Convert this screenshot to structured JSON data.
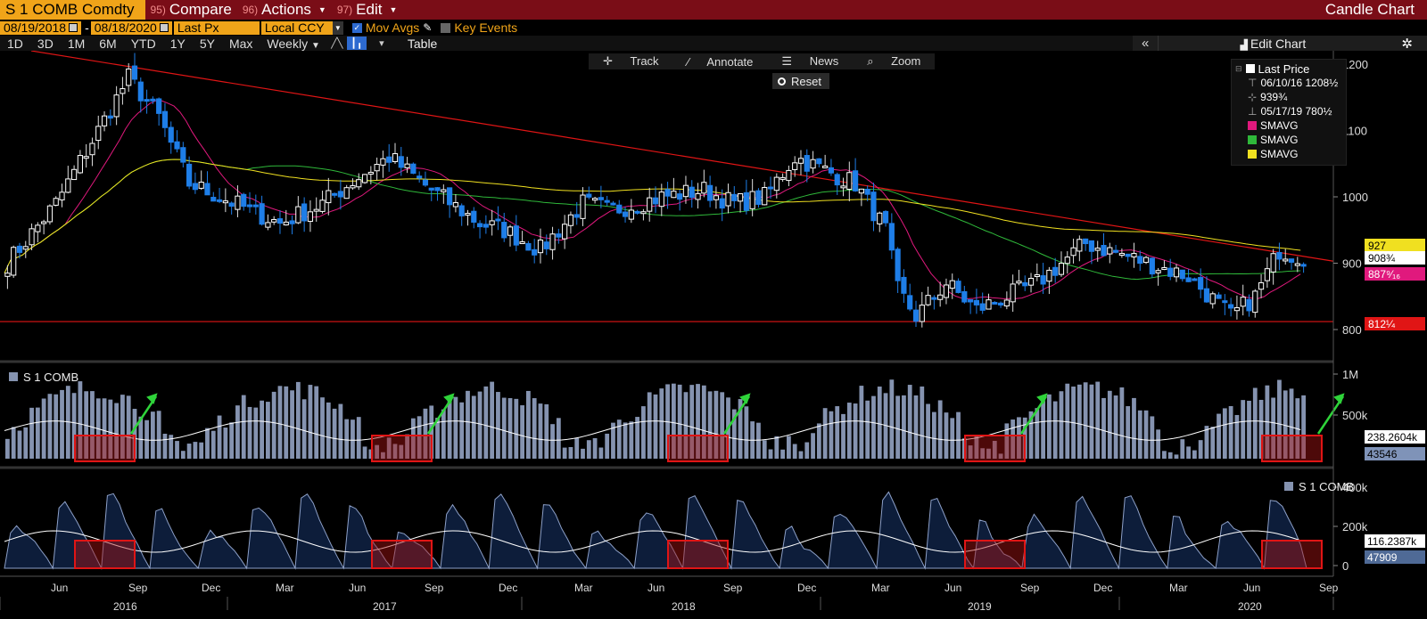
{
  "header": {
    "ticker": "S 1 COMB Comdty",
    "menus": [
      {
        "num": "95)",
        "label": "Compare",
        "caret": false
      },
      {
        "num": "96)",
        "label": "Actions",
        "caret": true
      },
      {
        "num": "97)",
        "label": "Edit",
        "caret": true
      }
    ],
    "chart_title": "Candle Chart"
  },
  "controls": {
    "start_date": "08/19/2018",
    "end_date": "08/18/2020",
    "date_sep": "-",
    "field": "Last Px",
    "currency": "Local CCY",
    "mov_avgs": "Mov Avgs",
    "key_events": "Key Events"
  },
  "periods": [
    "1D",
    "3D",
    "1M",
    "6M",
    "YTD",
    "1Y",
    "5Y",
    "Max"
  ],
  "frequency": "Weekly",
  "table_label": "Table",
  "edit_chart": "Edit Chart",
  "chart_tools": {
    "track": "Track",
    "annotate": "Annotate",
    "news": "News",
    "zoom": "Zoom",
    "reset": "Reset"
  },
  "legend": {
    "title": "Last Price",
    "high": "06/10/16 1208½",
    "avg": "939¾",
    "low": "05/17/19 780½",
    "sma": [
      {
        "label": "SMAVG",
        "color": "#e0197d"
      },
      {
        "label": "SMAVG",
        "color": "#2fb83a"
      },
      {
        "label": "SMAVG",
        "color": "#f0e020"
      }
    ]
  },
  "price_axis": {
    "ticks": [
      "1200",
      "1100",
      "1000",
      "900",
      "800"
    ],
    "tags": [
      {
        "text": "927",
        "bg": "#f0e020",
        "fg": "#000"
      },
      {
        "text": "908¾",
        "bg": "#ffffff",
        "fg": "#000"
      },
      {
        "text": "887⁹⁄₁₆",
        "bg": "#e0197d",
        "fg": "#fff"
      },
      {
        "text": "812¼",
        "bg": "#e01515",
        "fg": "#fff"
      }
    ]
  },
  "volume_panel": {
    "label": "S 1 COMB",
    "ticks": [
      "1M",
      "500k"
    ],
    "tags": [
      {
        "text": "238.2604k",
        "bg": "#ffffff",
        "fg": "#000"
      },
      {
        "text": "43546",
        "bg": "#7f93b8",
        "fg": "#000"
      }
    ]
  },
  "oi_panel": {
    "label": "S 1 COMB",
    "ticks": [
      "400k",
      "200k",
      "0"
    ],
    "tags": [
      {
        "text": "116.2387k",
        "bg": "#ffffff",
        "fg": "#000"
      },
      {
        "text": "47909",
        "bg": "#4f6a96",
        "fg": "#fff"
      }
    ]
  },
  "time_axis": {
    "months": [
      "Jun",
      "Sep",
      "Dec",
      "Mar",
      "Jun",
      "Sep",
      "Dec",
      "Mar",
      "Jun",
      "Sep",
      "Dec",
      "Mar",
      "Jun",
      "Sep",
      "Dec",
      "Mar",
      "Jun",
      "Sep"
    ],
    "years": [
      "2016",
      "2017",
      "2018",
      "2019",
      "2020"
    ]
  },
  "colors": {
    "up": "#ffffff",
    "down": "#1e7ee8",
    "trend": "#e01515",
    "volume": "#8593b0",
    "oi": "#0d1d3a",
    "highlight": "#e01515",
    "arrow": "#2fd43a"
  }
}
